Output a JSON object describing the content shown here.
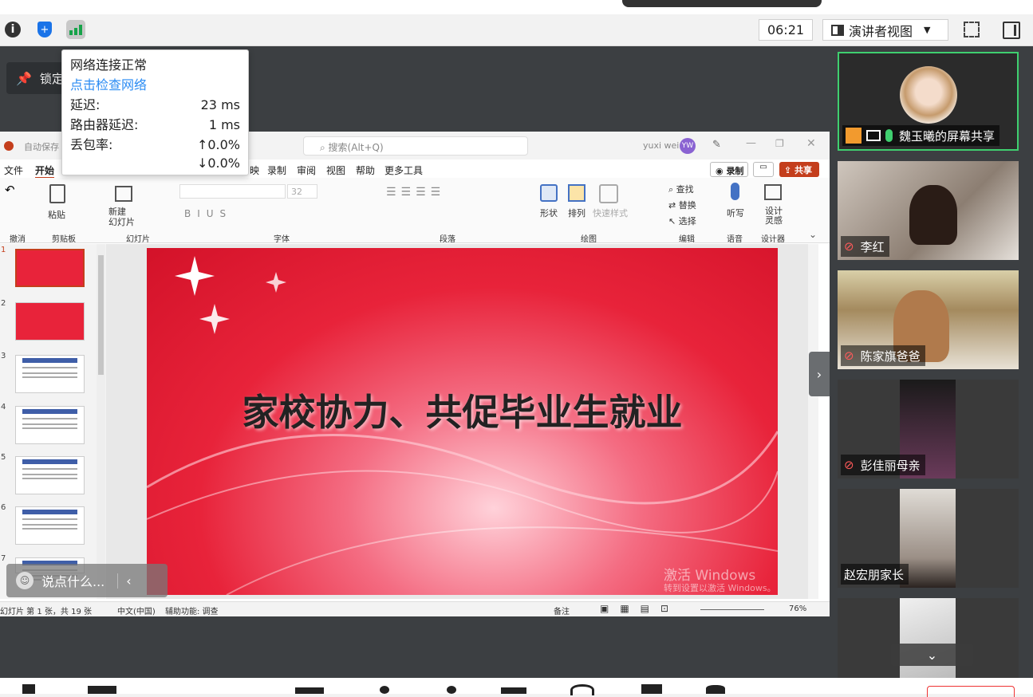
{
  "topbar": {
    "timer": "06:21",
    "view_label": "演讲者视图"
  },
  "lock": {
    "label": "锁定"
  },
  "net": {
    "title": "网络连接正常",
    "check": "点击检查网络",
    "rows": [
      {
        "label": "延迟:",
        "value": "23 ms"
      },
      {
        "label": "路由器延迟:",
        "value": "1 ms"
      },
      {
        "label": "丢包率:",
        "value": "↑0.0%"
      }
    ],
    "loss_down": "↓0.0%"
  },
  "ppt": {
    "autosave": "自动保存",
    "search": "搜索(Alt+Q)",
    "user": "yuxi wei",
    "avatar": "YW",
    "tabs": [
      "文件",
      "开始",
      "映",
      "录制",
      "审阅",
      "视图",
      "帮助",
      "更多工具"
    ],
    "record": "录制",
    "share": "共享",
    "ribbon": {
      "undo": "撤消",
      "paste": "粘贴",
      "clipboard": "剪贴板",
      "new_slide": "新建\n幻灯片",
      "slides": "幻灯片",
      "font_size": "32",
      "font": "字体",
      "paragraph": "段落",
      "shape": "形状",
      "arrange": "排列",
      "quick_style": "快速样式",
      "drawing": "绘图",
      "find": "查找",
      "replace": "替换",
      "select": "选择",
      "edit": "编辑",
      "dictate": "听写",
      "voice": "语音",
      "designer_btn": "设计\n灵感",
      "designer": "设计器"
    },
    "slide_title": "家校协力、共促毕业生就业",
    "thumbs": [
      "1",
      "2",
      "3",
      "4",
      "5",
      "6",
      "7"
    ],
    "activate1": "激活 Windows",
    "activate2": "转到设置以激活 Windows。",
    "status": {
      "left": "幻灯片 第 1 张，共 19 张",
      "lang": "中文(中国)",
      "access": "辅助功能: 调查",
      "notes": "备注",
      "zoom": "76%"
    }
  },
  "chat": {
    "placeholder": "说点什么..."
  },
  "participants": [
    {
      "name": "魏玉曦的屏幕共享"
    },
    {
      "name": "李红"
    },
    {
      "name": "陈家旗爸爸"
    },
    {
      "name": "彭佳丽母亲"
    },
    {
      "name": "赵宏朋家长"
    }
  ],
  "colors": {
    "accent": "#2b8cf3",
    "ppt_red": "#c43e1c",
    "slide_red": "#e8233a"
  }
}
